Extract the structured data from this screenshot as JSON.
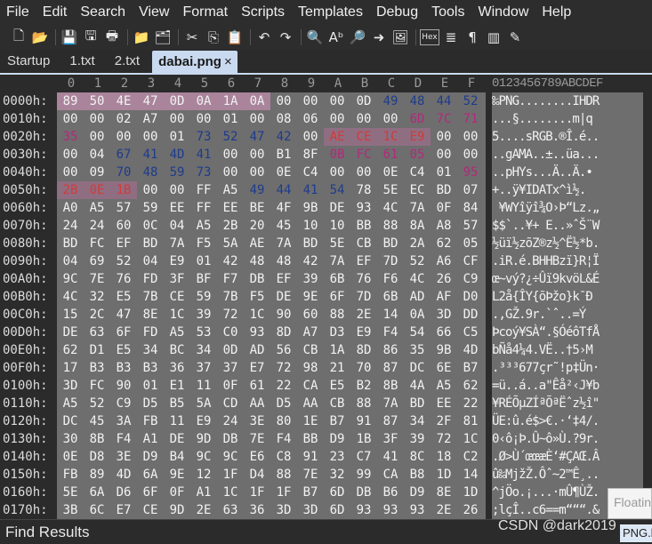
{
  "menu": [
    "File",
    "Edit",
    "Search",
    "View",
    "Format",
    "Scripts",
    "Templates",
    "Debug",
    "Tools",
    "Window",
    "Help"
  ],
  "toolbar": [
    {
      "name": "new-file-icon",
      "glyph": "🗋"
    },
    {
      "name": "open-icon",
      "glyph": "📂"
    },
    {
      "name": "save-icon",
      "glyph": "💾"
    },
    {
      "name": "save-all-icon",
      "glyph": "🖫"
    },
    {
      "name": "print-icon",
      "glyph": "🖶"
    },
    {
      "name": "folder-icon",
      "glyph": "📁"
    },
    {
      "name": "folders-icon",
      "glyph": "🗂"
    },
    {
      "name": "cut-icon",
      "glyph": "✂"
    },
    {
      "name": "copy-icon",
      "glyph": "⎘"
    },
    {
      "name": "paste-icon",
      "glyph": "📋"
    },
    {
      "name": "undo-icon",
      "glyph": "↶"
    },
    {
      "name": "redo-icon",
      "glyph": "↷"
    },
    {
      "name": "find-icon",
      "glyph": "🔍"
    },
    {
      "name": "replace-icon",
      "glyph": "Aᵇ"
    },
    {
      "name": "find-in-files-icon",
      "glyph": "🔎"
    },
    {
      "name": "goto-icon",
      "glyph": "➜"
    },
    {
      "name": "image-icon",
      "glyph": "🖼"
    },
    {
      "name": "hex-icon",
      "glyph": "Hex"
    },
    {
      "name": "list-icon",
      "glyph": "≣"
    },
    {
      "name": "paragraph-icon",
      "glyph": "¶"
    },
    {
      "name": "columns-icon",
      "glyph": "▥"
    },
    {
      "name": "highlighter-icon",
      "glyph": "✎"
    }
  ],
  "tabs": [
    {
      "label": "Startup",
      "active": false
    },
    {
      "label": "1.txt",
      "active": false
    },
    {
      "label": "2.txt",
      "active": false
    },
    {
      "label": "dabai.png",
      "active": true,
      "close": "×"
    }
  ],
  "ruler": [
    "0",
    "1",
    "2",
    "3",
    "4",
    "5",
    "6",
    "7",
    "8",
    "9",
    "A",
    "B",
    "C",
    "D",
    "E",
    "F"
  ],
  "ascii_ruler": "0123456789ABCDEF",
  "hex": {
    "offsets": [
      "0000h:",
      "0010h:",
      "0020h:",
      "0030h:",
      "0040h:",
      "0050h:",
      "0060h:",
      "0070h:",
      "0080h:",
      "0090h:",
      "00A0h:",
      "00B0h:",
      "00C0h:",
      "00D0h:",
      "00E0h:",
      "00F0h:",
      "0100h:",
      "0110h:",
      "0120h:",
      "0130h:",
      "0140h:",
      "0150h:",
      "0160h:",
      "0170h:"
    ],
    "rows": [
      [
        "89",
        "50",
        "4E",
        "47",
        "0D",
        "0A",
        "1A",
        "0A",
        "00",
        "00",
        "00",
        "0D",
        "49",
        "48",
        "44",
        "52"
      ],
      [
        "00",
        "00",
        "02",
        "A7",
        "00",
        "00",
        "01",
        "00",
        "08",
        "06",
        "00",
        "00",
        "00",
        "6D",
        "7C",
        "71"
      ],
      [
        "35",
        "00",
        "00",
        "00",
        "01",
        "73",
        "52",
        "47",
        "42",
        "00",
        "AE",
        "CE",
        "1C",
        "E9",
        "00",
        "00"
      ],
      [
        "00",
        "04",
        "67",
        "41",
        "4D",
        "41",
        "00",
        "00",
        "B1",
        "8F",
        "0B",
        "FC",
        "61",
        "05",
        "00",
        "00"
      ],
      [
        "00",
        "09",
        "70",
        "48",
        "59",
        "73",
        "00",
        "00",
        "0E",
        "C4",
        "00",
        "00",
        "0E",
        "C4",
        "01",
        "95"
      ],
      [
        "2B",
        "0E",
        "1B",
        "00",
        "00",
        "FF",
        "A5",
        "49",
        "44",
        "41",
        "54",
        "78",
        "5E",
        "EC",
        "BD",
        "07"
      ],
      [
        "A0",
        "A5",
        "57",
        "59",
        "EE",
        "FF",
        "EE",
        "BE",
        "4F",
        "9B",
        "DE",
        "93",
        "4C",
        "7A",
        "0F",
        "84"
      ],
      [
        "24",
        "24",
        "60",
        "0C",
        "04",
        "A5",
        "2B",
        "20",
        "45",
        "10",
        "10",
        "BB",
        "88",
        "8A",
        "A8",
        "57"
      ],
      [
        "BD",
        "FC",
        "EF",
        "BD",
        "7A",
        "F5",
        "5A",
        "AE",
        "7A",
        "BD",
        "5E",
        "CB",
        "BD",
        "2A",
        "62",
        "05"
      ],
      [
        "04",
        "69",
        "52",
        "04",
        "E9",
        "01",
        "42",
        "48",
        "48",
        "42",
        "7A",
        "EF",
        "7D",
        "52",
        "A6",
        "CF"
      ],
      [
        "9C",
        "7E",
        "76",
        "FD",
        "3F",
        "BF",
        "F7",
        "DB",
        "EF",
        "39",
        "6B",
        "76",
        "F6",
        "4C",
        "26",
        "C9"
      ],
      [
        "4C",
        "32",
        "E5",
        "7B",
        "CE",
        "59",
        "7B",
        "F5",
        "DE",
        "9E",
        "6F",
        "7D",
        "6B",
        "AD",
        "AF",
        "D0"
      ],
      [
        "15",
        "2C",
        "47",
        "8E",
        "1C",
        "39",
        "72",
        "1C",
        "90",
        "60",
        "88",
        "2E",
        "14",
        "0A",
        "3D",
        "DD"
      ],
      [
        "DE",
        "63",
        "6F",
        "FD",
        "A5",
        "53",
        "C0",
        "93",
        "8D",
        "A7",
        "D3",
        "E9",
        "F4",
        "54",
        "66",
        "C5"
      ],
      [
        "62",
        "D1",
        "E5",
        "34",
        "BC",
        "34",
        "0D",
        "AD",
        "56",
        "CB",
        "1A",
        "8D",
        "86",
        "35",
        "9B",
        "4D"
      ],
      [
        "17",
        "B3",
        "B3",
        "B3",
        "36",
        "37",
        "37",
        "E7",
        "72",
        "98",
        "21",
        "70",
        "87",
        "DC",
        "6E",
        "B7"
      ],
      [
        "3D",
        "FC",
        "90",
        "01",
        "E1",
        "11",
        "0F",
        "61",
        "22",
        "CA",
        "E5",
        "B2",
        "8B",
        "4A",
        "A5",
        "62"
      ],
      [
        "A5",
        "52",
        "C9",
        "D5",
        "B5",
        "5A",
        "CD",
        "AA",
        "D5",
        "AA",
        "CB",
        "88",
        "7A",
        "BD",
        "EE",
        "22"
      ],
      [
        "DC",
        "45",
        "3A",
        "FB",
        "11",
        "E9",
        "24",
        "3E",
        "80",
        "1E",
        "B7",
        "91",
        "87",
        "34",
        "2F",
        "81"
      ],
      [
        "30",
        "8B",
        "F4",
        "A1",
        "DE",
        "9D",
        "DB",
        "7E",
        "F4",
        "BB",
        "D9",
        "1B",
        "3F",
        "39",
        "72",
        "1C"
      ],
      [
        "0E",
        "D8",
        "3E",
        "D9",
        "B4",
        "9C",
        "9C",
        "E6",
        "C8",
        "91",
        "23",
        "C7",
        "41",
        "8C",
        "18",
        "C2"
      ],
      [
        "FB",
        "89",
        "4D",
        "6A",
        "9E",
        "12",
        "1F",
        "D4",
        "88",
        "7E",
        "32",
        "99",
        "CA",
        "B8",
        "1D",
        "14"
      ],
      [
        "5E",
        "6A",
        "D6",
        "6F",
        "0F",
        "A1",
        "1C",
        "1F",
        "1F",
        "B7",
        "6D",
        "DB",
        "B6",
        "D9",
        "8E",
        "1D"
      ],
      [
        "3B",
        "6C",
        "E7",
        "CE",
        "9D",
        "2E",
        "63",
        "36",
        "3D",
        "3D",
        "6D",
        "93",
        "93",
        "93",
        "2E",
        "26"
      ]
    ],
    "ascii": [
      "‰PNG........IHDR",
      "...§........m|q",
      "5....sRGB.®Î.é..",
      "..gAMA..±..üa...",
      "..pHYs...Ä..Ä.•",
      "+..ÿ¥IDATx^ì½.",
      " ¥WYîÿî¾O›Þ“Lz.„",
      "$$`..¥+ E..»ˆŠ¨W",
      "½üï½zõZ®z½^Ë½*b.",
      ".iR.é.BHHBzï}R¦Ï",
      "œ~vý?¿÷Ûï9kvöL&É",
      "L2å{ÎY{õÞžo}k­¯Ð",
      ".,GŽ.9r.`ˆ..=Ý",
      "Þcoý¥SÀ“.§ÓéôTfÅ",
      "bÑå4¼4.­VË..†5›M",
      ".³³³677çr˜!p‡Ün·",
      "=ü..á..a\"Êå²‹J¥b",
      "¥RÉÕµZÍªÕªËˆz½î\"",
      "ÜE:û.é$>€.·‘‡4/.",
      "0‹ô¡Þ.Û~ô»Ù.?9r.",
      ".Ø>Ù´œœæÈ‘#ÇAŒ.Â",
      "û‰MjžŽ.Ôˆ~2™Ê¸..",
      "^jÖo.¡...·mÛ¶ÙŽ.",
      ";lçÎ..c6==m“““.&"
    ],
    "highlight_byte_color": "#a9849b",
    "chunk_text_color": "#1e3c8c",
    "crc_text_color": "#b02a7a",
    "grey_bg": "#6e6e6e"
  },
  "status": {
    "find_results": "Find Results"
  },
  "watermark": "CSDN @dark2019",
  "floating": {
    "title": "Floatin",
    "sub": "PNG.bt"
  }
}
